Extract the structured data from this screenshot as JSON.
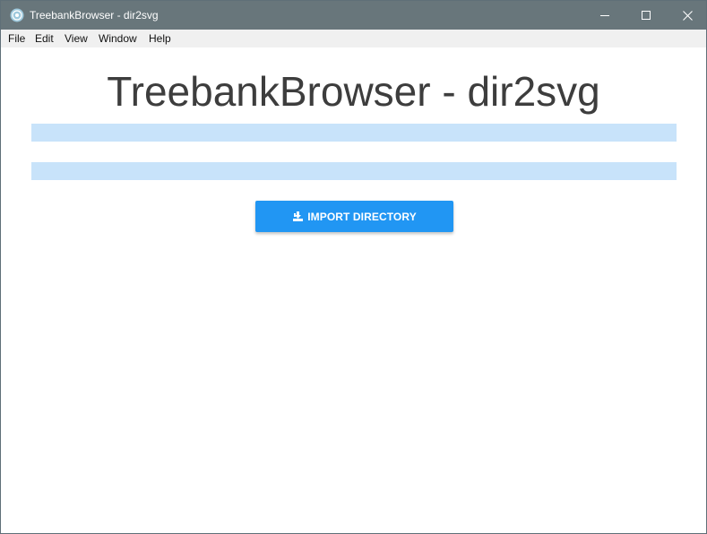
{
  "window": {
    "title": "TreebankBrowser - dir2svg"
  },
  "menu": {
    "items": [
      "File",
      "Edit",
      "View",
      "Window",
      "Help"
    ]
  },
  "main": {
    "heading": "TreebankBrowser - dir2svg",
    "import_button": {
      "label": "IMPORT DIRECTORY",
      "icon": "import-icon"
    }
  },
  "colors": {
    "titlebar": "#68767b",
    "accent": "#2196f3",
    "field_highlight": "#c8e3fa"
  }
}
